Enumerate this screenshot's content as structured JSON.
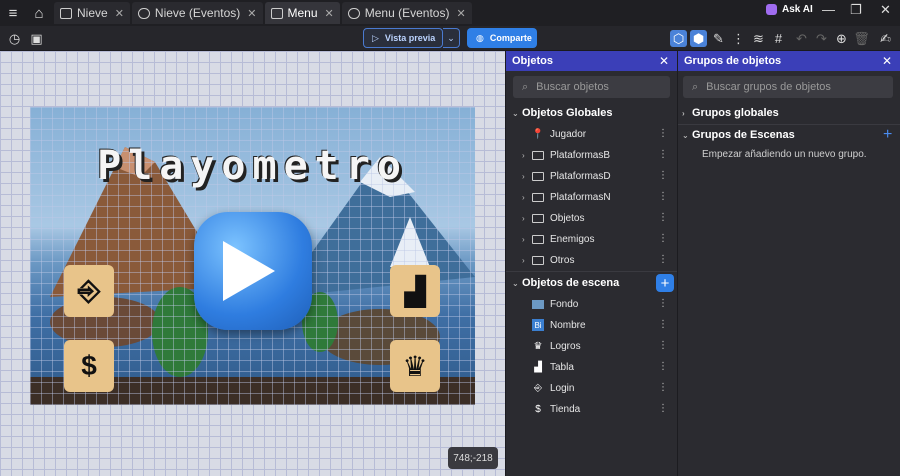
{
  "tabs": [
    {
      "label": "Nieve"
    },
    {
      "label": "Nieve (Eventos)"
    },
    {
      "label": "Menu"
    },
    {
      "label": "Menu (Eventos)"
    }
  ],
  "ask_ai": "Ask AI",
  "toolbar": {
    "preview_label": "Vista previa",
    "share_label": "Comparte"
  },
  "scene": {
    "title": "Playometro"
  },
  "coord_readout": "748;-218",
  "objects_panel": {
    "title": "Objetos",
    "search_placeholder": "Buscar objetos",
    "global_section": "Objetos Globales",
    "global_items": [
      {
        "label": "Jugador",
        "icon": "pin-icon",
        "folder": false
      },
      {
        "label": "PlataformasB",
        "folder": true
      },
      {
        "label": "PlataformasD",
        "folder": true
      },
      {
        "label": "PlataformasN",
        "folder": true
      },
      {
        "label": "Objetos",
        "folder": true
      },
      {
        "label": "Enemigos",
        "folder": true
      },
      {
        "label": "Otros",
        "folder": true
      }
    ],
    "scene_section": "Objetos de escena",
    "scene_items": [
      {
        "label": "Fondo",
        "icon": "image-icon"
      },
      {
        "label": "Nombre",
        "icon": "text-object-icon"
      },
      {
        "label": "Logros",
        "icon": "trophy-icon"
      },
      {
        "label": "Tabla",
        "icon": "bar-chart-icon"
      },
      {
        "label": "Login",
        "icon": "login-icon"
      },
      {
        "label": "Tienda",
        "icon": "dollar-icon"
      }
    ]
  },
  "groups_panel": {
    "title": "Grupos de objetos",
    "search_placeholder": "Buscar grupos de objetos",
    "global_groups": "Grupos globales",
    "scene_groups": "Grupos de Escenas",
    "empty_message": "Empezar añadiendo un nuevo grupo."
  },
  "colors": {
    "accent": "#2f7fe6",
    "panel_header": "#3b3fb8"
  }
}
